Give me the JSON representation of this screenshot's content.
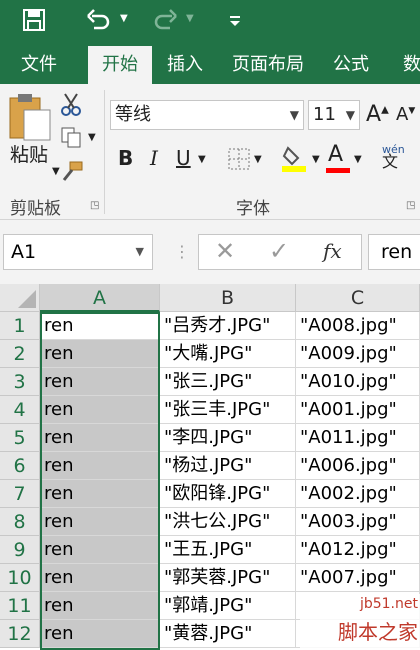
{
  "colors": {
    "accent": "#217346",
    "ribbon_bg": "#f3f3f3",
    "selected_cell": "#c8c8c8"
  },
  "quick_access": {
    "save_icon": "save-icon",
    "undo_icon": "undo-icon",
    "redo_icon": "redo-icon",
    "customize_icon": "customize-icon"
  },
  "tabs": [
    {
      "label": "文件",
      "active": false
    },
    {
      "label": "开始",
      "active": true
    },
    {
      "label": "插入",
      "active": false
    },
    {
      "label": "页面布局",
      "active": false
    },
    {
      "label": "公式",
      "active": false
    },
    {
      "label": "数",
      "active": false
    }
  ],
  "ribbon": {
    "clipboard": {
      "paste_label": "粘贴",
      "group_label": "剪贴板"
    },
    "font": {
      "font_name": "等线",
      "font_size": "11",
      "bold": "B",
      "italic": "I",
      "underline": "U",
      "fill_glyph": "A",
      "phonetic": "wén",
      "phonetic_glyph": "文",
      "group_label": "字体"
    }
  },
  "formula_bar": {
    "name_box": "A1",
    "fx_label": "fx",
    "content": "ren"
  },
  "sheet": {
    "columns": [
      "A",
      "B",
      "C"
    ],
    "rows": [
      {
        "n": "1",
        "a": "ren",
        "b": "\"吕秀才.JPG\"",
        "c": "\"A008.jpg\""
      },
      {
        "n": "2",
        "a": "ren",
        "b": "\"大嘴.JPG\"",
        "c": "\"A009.jpg\""
      },
      {
        "n": "3",
        "a": "ren",
        "b": "\"张三.JPG\"",
        "c": "\"A010.jpg\""
      },
      {
        "n": "4",
        "a": "ren",
        "b": "\"张三丰.JPG\"",
        "c": "\"A001.jpg\""
      },
      {
        "n": "5",
        "a": "ren",
        "b": "\"李四.JPG\"",
        "c": "\"A011.jpg\""
      },
      {
        "n": "6",
        "a": "ren",
        "b": "\"杨过.JPG\"",
        "c": "\"A006.jpg\""
      },
      {
        "n": "7",
        "a": "ren",
        "b": "\"欧阳锋.JPG\"",
        "c": "\"A002.jpg\""
      },
      {
        "n": "8",
        "a": "ren",
        "b": "\"洪七公.JPG\"",
        "c": "\"A003.jpg\""
      },
      {
        "n": "9",
        "a": "ren",
        "b": "\"王五.JPG\"",
        "c": "\"A012.jpg\""
      },
      {
        "n": "10",
        "a": "ren",
        "b": "\"郭芙蓉.JPG\"",
        "c": "\"A007.jpg\""
      },
      {
        "n": "11",
        "a": "ren",
        "b": "\"郭靖.JPG\"",
        "c": ""
      },
      {
        "n": "12",
        "a": "ren",
        "b": "\"黄蓉.JPG\"",
        "c": ""
      }
    ]
  },
  "watermark": {
    "site": "jb51.net",
    "name": "脚本之家"
  }
}
